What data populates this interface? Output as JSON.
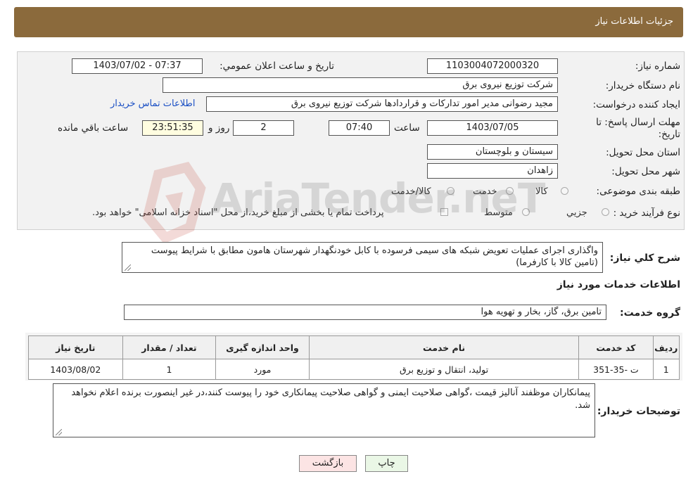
{
  "header": {
    "title": "جزئيات اطلاعات نياز"
  },
  "form": {
    "need_number_label": "شماره نياز:",
    "need_number": "1103004072000320",
    "announce_label": "تاريخ و ساعت اعلان عمومي:",
    "announce_value": "1403/07/02 - 07:37",
    "buyer_org_label": "نام دستگاه خريدار:",
    "buyer_org": "شرکت توزیع نیروی برق",
    "requester_label": "ايجاد کننده درخواست:",
    "requester": "مجید  رضوانی مدیر امور تدارکات و قراردادها شرکت توزیع نیروی برق",
    "contact_link": "اطلاعات تماس خريدار",
    "deadline_label_1": "مهلت ارسال پاسخ: تا",
    "deadline_label_2": "تاريخ:",
    "deadline_date": "1403/07/05",
    "time_label": "ساعت",
    "deadline_time": "07:40",
    "days_value": "2",
    "days_label": "روز و",
    "remaining_time": "23:51:35",
    "remaining_label": "ساعت باقي مانده",
    "province_label": "استان محل تحويل:",
    "province": "سیستان و بلوچستان",
    "city_label": "شهر محل تحويل:",
    "city": "زاهدان",
    "category_label": "طبقه بندی موضوعی:",
    "category_options": [
      "کالا",
      "خدمت",
      "کالا/خدمت"
    ],
    "process_label": "نوع فرآيند خريد :",
    "process_options": [
      "جزيي",
      "متوسط"
    ],
    "payment_note": "پرداخت تمام يا بخشی از مبلغ خريد،از محل \"اسناد خزانه اسلامی\" خواهد بود."
  },
  "description": {
    "label": "شرح کلي نياز:",
    "text": "واگذاری اجرای عملیات تعویض شبکه های سیمی فرسوده با کابل خودنگهدار شهرستان هامون مطابق با شرایط پیوست (تامین کالا با کارفرما)"
  },
  "services": {
    "section_title": "اطلاعات خدمات مورد نياز",
    "group_label": "گروه خدمت:",
    "group_value": "تامین برق، گاز، بخار و تهویه هوا",
    "columns": [
      "رديف",
      "کد خدمت",
      "نام خدمت",
      "واحد اندازه گيری",
      "تعداد / مقدار",
      "تاريخ نياز"
    ],
    "rows": [
      [
        "1",
        "ت -35-351",
        "تولید، انتقال و توزیع برق",
        "مورد",
        "1",
        "1403/08/02"
      ]
    ]
  },
  "buyer_notes": {
    "label": "توضيحات خريدار:",
    "text": "پیمانکاران موظفند آنالیز قیمت ،گواهی صلاحیت ایمنی و گواهی صلاحیت پیمانکاری خود را پیوست کنند،در غیر اینصورت برنده اعلام نخواهد شد."
  },
  "buttons": {
    "print": "چاپ",
    "back": "بازگشت"
  },
  "colors": {
    "header_bg": "#8b6a3c",
    "link": "#1a4fc4",
    "back_button_bg": "#fce4e4",
    "print_button_bg": "#eaf7e6"
  },
  "watermark": {
    "text": "AriaTender.neT"
  }
}
